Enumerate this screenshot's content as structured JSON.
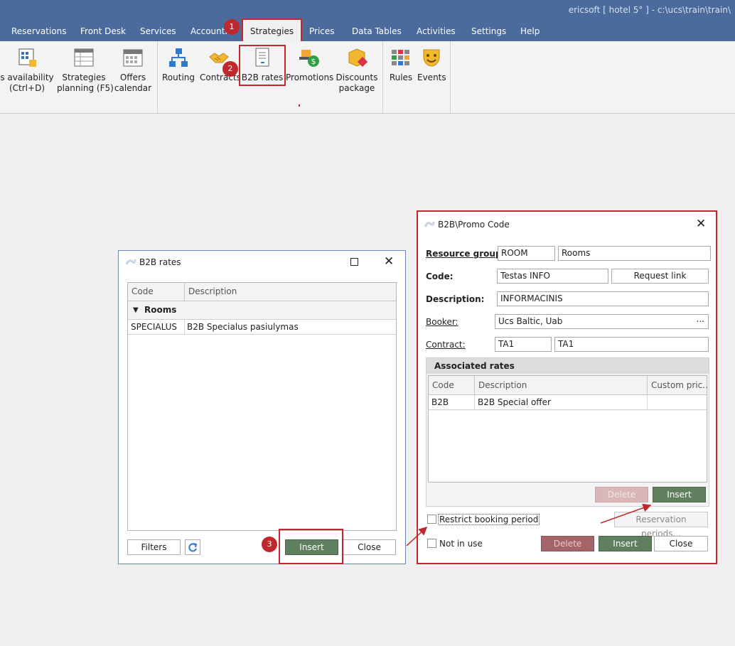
{
  "app": {
    "title": "ericsoft [ hotel 5° ] - c:\\ucs\\train\\train\\"
  },
  "tabs": [
    "Reservations",
    "Front Desk",
    "Services",
    "Accounting",
    "Strategies",
    "Prices",
    "Data Tables",
    "Activities",
    "Settings",
    "Help"
  ],
  "ribbon": {
    "availability": {
      "line1": "s availability",
      "line2": "(Ctrl+D)"
    },
    "strategies_planning": {
      "line1": "Strategies",
      "line2": "planning (F5)"
    },
    "offers_calendar": {
      "line1": "Offers",
      "line2": "calendar"
    },
    "routing": "Routing",
    "contracts": "Contracts",
    "b2b_rates": "B2B rates",
    "promotions": "Promotions",
    "discounts_package": {
      "line1": "Discounts",
      "line2": "package"
    },
    "rules": "Rules",
    "events": "Events"
  },
  "badges": [
    "1",
    "2",
    "3"
  ],
  "b2b_rates_window": {
    "title": "B2B rates",
    "columns": [
      "Code",
      "Description"
    ],
    "group": "Rooms",
    "rows": [
      {
        "code": "SPECIALUS",
        "description": "B2B Specialus pasiulymas"
      }
    ],
    "filters_label": "Filters",
    "insert_label": "Insert",
    "close_label": "Close"
  },
  "promo_window": {
    "title": "B2B\\Promo Code",
    "resource_group_label": "Resource group:",
    "resource_group_code": "ROOM",
    "resource_group_name": "Rooms",
    "code_label": "Code:",
    "code_value": "Testas INFO",
    "request_link_label": "Request link",
    "description_label": "Description:",
    "description_value": "INFORMACINIS",
    "booker_label": "Booker:",
    "booker_value": "Ucs Baltic, Uab",
    "booker_more": "...",
    "contract_label": "Contract:",
    "contract_code": "TA1",
    "contract_name": "TA1",
    "associated_rates_label": "Associated rates",
    "rates_columns": [
      "Code",
      "Description",
      "Custom pric..."
    ],
    "rates_rows": [
      {
        "code": "B2B",
        "description": "B2B Special offer",
        "custom_price": ""
      }
    ],
    "rates_delete_label": "Delete",
    "rates_insert_label": "Insert",
    "restrict_booking_label": "Restrict booking period",
    "reservation_periods_label": "Reservation periods...",
    "not_in_use_label": "Not in use",
    "delete_label": "Delete",
    "insert_label": "Insert",
    "close_label": "Close"
  },
  "colors": {
    "titlebar": "#4b6b9c",
    "highlight": "#c0282d",
    "insert_green": "#5f7f5f",
    "delete_red": "#a46468"
  }
}
